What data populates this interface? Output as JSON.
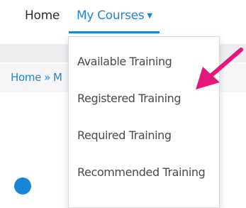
{
  "nav": {
    "home_label": "Home",
    "my_courses_label": "My Courses",
    "my_courses_icon": "caret-down-icon",
    "accent_color": "#1a86d8"
  },
  "breadcrumb": {
    "home_label": "Home",
    "separator": "»",
    "next_partial": "M"
  },
  "dropdown": {
    "items": [
      {
        "label": "Available Training"
      },
      {
        "label": "Registered Training"
      },
      {
        "label": "Required Training"
      },
      {
        "label": "Recommended Training"
      }
    ]
  },
  "annotation": {
    "icon": "arrow-icon",
    "color": "#e5177d",
    "points_to": "Registered Training"
  },
  "avatar": {
    "icon": "avatar-icon",
    "color": "#1a86d8"
  }
}
